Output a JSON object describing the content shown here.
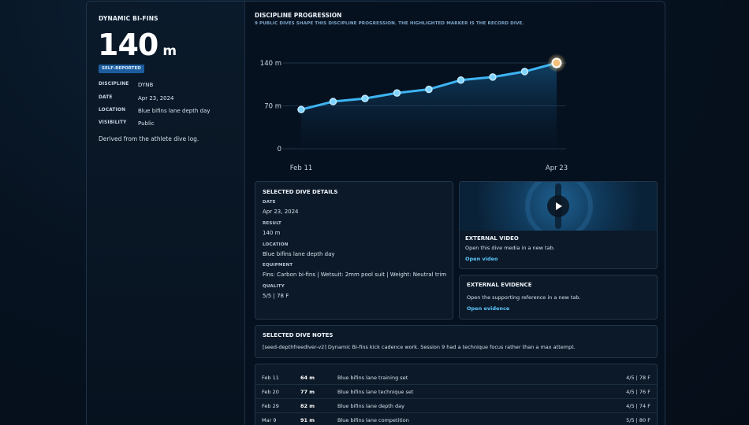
{
  "summary": {
    "discipline_title": "DYNAMIC BI-FINS",
    "result_value": "140",
    "result_unit": "m",
    "badge": "SELF-REPORTED",
    "meta": [
      {
        "key": "DISCIPLINE",
        "value": "DYNB"
      },
      {
        "key": "DATE",
        "value": "Apr 23, 2024"
      },
      {
        "key": "LOCATION",
        "value": "Blue bifins lane depth day"
      },
      {
        "key": "VISIBILITY",
        "value": "Public"
      }
    ],
    "derived_note": "Derived from the athlete dive log."
  },
  "progression": {
    "title": "DISCIPLINE PROGRESSION",
    "subtitle": "9 PUBLIC DIVES SHAPE THIS DISCIPLINE PROGRESSION. THE HIGHLIGHTED MARKER IS THE RECORD DIVE."
  },
  "chart_data": {
    "type": "area",
    "x": [
      "Feb 11",
      "Feb 20",
      "Feb 29",
      "Mar 9",
      "",
      "",
      "",
      "",
      "Apr 23"
    ],
    "series": [
      {
        "values": [
          64,
          77,
          82,
          91,
          97,
          112,
          117,
          126,
          140
        ]
      }
    ],
    "ylim": [
      0,
      140
    ],
    "y_ticks": [
      "0",
      "70 m",
      "140 m"
    ],
    "x_tick_labels": [
      "Feb 11",
      "Apr 23"
    ],
    "highlight_index": 8,
    "colors": {
      "line": "#3db4f2",
      "highlight": "#f5c07a"
    }
  },
  "selected": {
    "title": "SELECTED DIVE DETAILS",
    "fields": [
      {
        "label": "DATE",
        "value": "Apr 23, 2024"
      },
      {
        "label": "RESULT",
        "value": "140 m"
      },
      {
        "label": "LOCATION",
        "value": "Blue bifins lane depth day"
      },
      {
        "label": "EQUIPMENT",
        "value": "Fins: Carbon bi-fins | Wetsuit: 2mm pool suit | Weight: Neutral trim"
      },
      {
        "label": "QUALITY",
        "value": "5/5 | 78 F"
      }
    ]
  },
  "video": {
    "title": "EXTERNAL VIDEO",
    "desc": "Open this dive media in a new tab.",
    "link": "Open video"
  },
  "evidence": {
    "title": "EXTERNAL EVIDENCE",
    "desc": "Open the supporting reference in a new tab.",
    "link": "Open evidence"
  },
  "notes": {
    "title": "SELECTED DIVE NOTES",
    "text": "[seed-depthfreediver-v2] Dynamic Bi-fins kick cadence work. Session 9 had a technique focus rather than a max attempt."
  },
  "log": [
    {
      "date": "Feb 11",
      "result": "64 m",
      "location": "Blue bifins lane training set",
      "quality": "4/5 | 78 F"
    },
    {
      "date": "Feb 20",
      "result": "77 m",
      "location": "Blue bifins lane technique set",
      "quality": "4/5 | 76 F"
    },
    {
      "date": "Feb 29",
      "result": "82 m",
      "location": "Blue bifins lane depth day",
      "quality": "4/5 | 74 F"
    },
    {
      "date": "Mar 9",
      "result": "91 m",
      "location": "Blue bifins lane competition",
      "quality": "5/5 | 80 F"
    }
  ]
}
